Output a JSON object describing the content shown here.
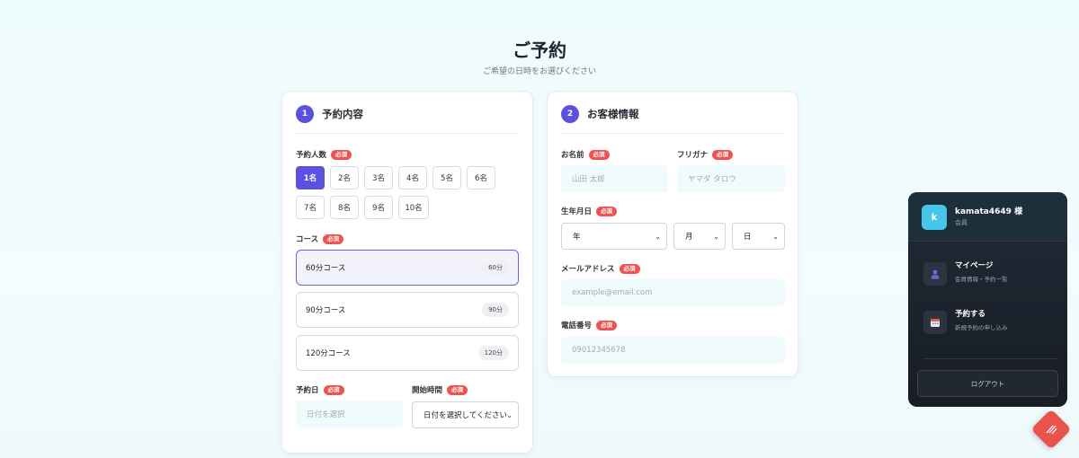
{
  "page": {
    "title": "ご予約",
    "subtitle": "ご希望の日時をお選びください"
  },
  "required_label": "必須",
  "section1": {
    "step": "1",
    "title": "予約内容",
    "people_label": "予約人数",
    "people_options": [
      "1名",
      "2名",
      "3名",
      "4名",
      "5名",
      "6名",
      "7名",
      "8名",
      "9名",
      "10名"
    ],
    "people_selected": "1名",
    "course_label": "コース",
    "courses": [
      {
        "name": "60分コース",
        "badge": "60分"
      },
      {
        "name": "90分コース",
        "badge": "90分"
      },
      {
        "name": "120分コース",
        "badge": "120分"
      }
    ],
    "date_label": "予約日",
    "date_placeholder": "日付を選択",
    "time_label": "開始時間",
    "time_value": "日付を選択してください"
  },
  "section2": {
    "step": "2",
    "title": "お客様情報",
    "name_label": "お名前",
    "name_placeholder": "山田 太郎",
    "kana_label": "フリガナ",
    "kana_placeholder": "ヤマダ タロウ",
    "birth_label": "生年月日",
    "birth_year": "年",
    "birth_month": "月",
    "birth_day": "日",
    "email_label": "メールアドレス",
    "email_placeholder": "example@email.com",
    "phone_label": "電話番号",
    "phone_placeholder": "09012345678"
  },
  "sidebar": {
    "avatar_letter": "k",
    "username": "kamata4649 様",
    "role": "会員",
    "items": [
      {
        "title": "マイページ",
        "desc": "会員情報・予約一覧",
        "icon": "user-icon"
      },
      {
        "title": "予約する",
        "desc": "新規予約の申し込み",
        "icon": "calendar-icon"
      }
    ],
    "logout": "ログアウト"
  },
  "colors": {
    "accent": "#5a51e1",
    "required": "#ef5350",
    "fab": "#e9534b",
    "sidebar_bg": "#1c222c"
  }
}
